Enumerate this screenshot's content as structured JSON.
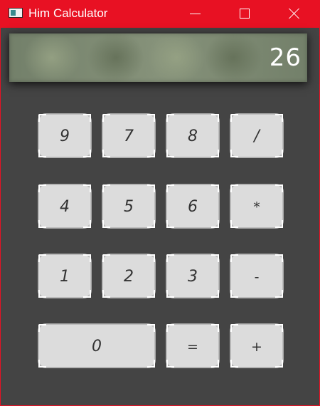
{
  "window": {
    "title": "Him Calculator",
    "accent_color": "#e81123",
    "background_color": "#444444",
    "controls": [
      "minimize-icon",
      "maximize-icon",
      "close-icon"
    ]
  },
  "display": {
    "value": "26"
  },
  "keypad": {
    "rows": [
      [
        "9",
        "7",
        "8",
        "/"
      ],
      [
        "4",
        "5",
        "6",
        "*"
      ],
      [
        "1",
        "2",
        "3",
        "-"
      ],
      [
        "0",
        "=",
        "+"
      ]
    ]
  }
}
